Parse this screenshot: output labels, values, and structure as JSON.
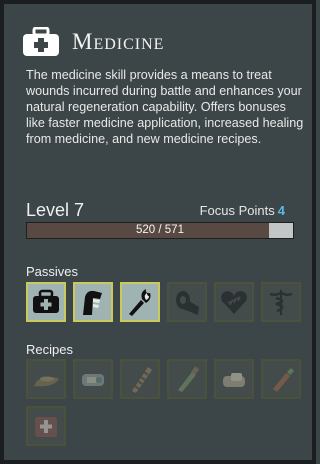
{
  "skill": {
    "title": "Medicine",
    "icon": "medkit-icon",
    "description": "The medicine skill provides a means to treat wounds incurred during battle and enhances your natural regeneration capability. Offers bonuses like faster medicine application, increased healing from medicine, and new medicine recipes."
  },
  "progress": {
    "level_label": "Level 7",
    "focus_label": "Focus Points",
    "focus_value": "4",
    "xp_text": "520 / 571",
    "xp_fraction": 0.91
  },
  "passives": {
    "label": "Passives",
    "items": [
      {
        "icon": "medkit-icon",
        "unlocked": true
      },
      {
        "icon": "bandaged-arm-icon",
        "unlocked": true
      },
      {
        "icon": "torch-icon",
        "unlocked": true
      },
      {
        "icon": "bandage-roll-icon",
        "unlocked": false
      },
      {
        "icon": "stitched-heart-icon",
        "unlocked": false
      },
      {
        "icon": "caduceus-icon",
        "unlocked": false
      }
    ]
  },
  "recipes": {
    "label": "Recipes",
    "items": [
      {
        "icon": "poultice-icon"
      },
      {
        "icon": "salve-tin-icon"
      },
      {
        "icon": "splint-icon"
      },
      {
        "icon": "vial-icon"
      },
      {
        "icon": "ointment-icon"
      },
      {
        "icon": "syringe-icon"
      },
      {
        "icon": "medkit-recipe-icon"
      }
    ]
  },
  "colors": {
    "panel": "#3c4547",
    "focus_value": "#5fb6e6",
    "xp_fill": "#594943",
    "slot_border_active": "#c9c95e"
  }
}
